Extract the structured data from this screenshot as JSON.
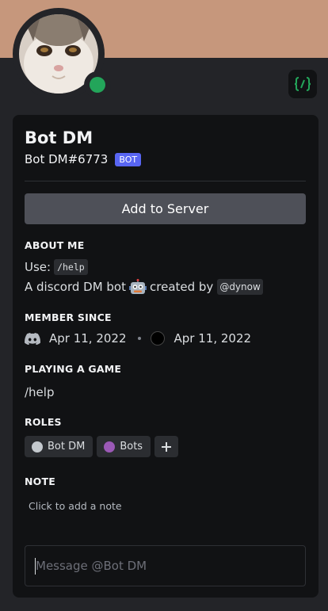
{
  "profile": {
    "display_name": "Bot DM",
    "tag": "Bot DM#6773",
    "bot_badge": "BOT",
    "status_color": "#23a55a",
    "banner_color": "#c6977c"
  },
  "actions": {
    "add_to_server": "Add to Server"
  },
  "about_me": {
    "heading": "ABOUT ME",
    "line1_prefix": "Use:",
    "line1_code": "/help",
    "line2_prefix": "A discord DM bot",
    "line2_emoji": "robot-emoji",
    "line2_middle": "created by",
    "line2_mention": "@dynow"
  },
  "member_since": {
    "heading": "MEMBER SINCE",
    "discord_date": "Apr 11, 2022",
    "server_date": "Apr 11, 2022"
  },
  "activity": {
    "heading": "PLAYING A GAME",
    "game": "/help"
  },
  "roles": {
    "heading": "ROLES",
    "items": [
      {
        "name": "Bot DM",
        "color": "#c4c9ce"
      },
      {
        "name": "Bots",
        "color": "#9b59b6"
      }
    ],
    "add_icon": "plus-icon"
  },
  "note": {
    "heading": "NOTE",
    "placeholder": "Click to add a note"
  },
  "message": {
    "placeholder": "Message @Bot DM"
  }
}
